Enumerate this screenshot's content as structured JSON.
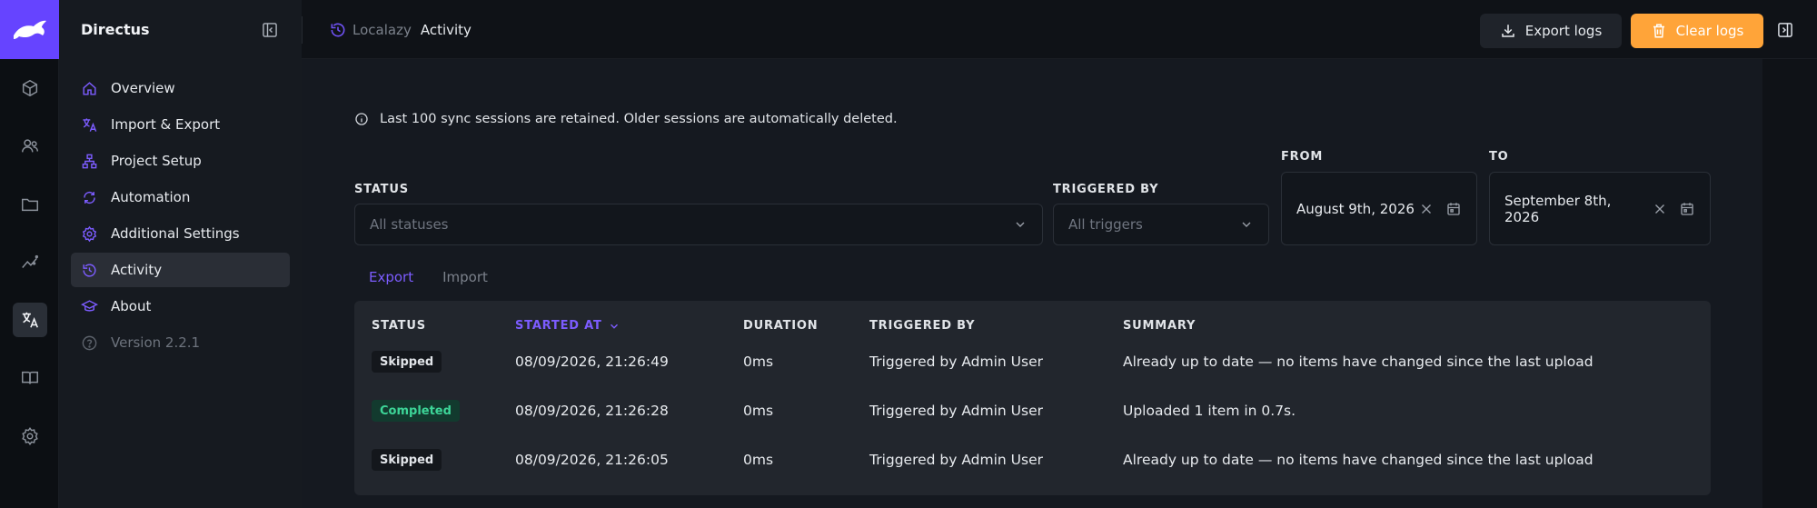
{
  "app": {
    "name": "Directus"
  },
  "modules": [
    {
      "name": "content",
      "icon": "cube-icon"
    },
    {
      "name": "users",
      "icon": "users-icon"
    },
    {
      "name": "files",
      "icon": "folder-icon"
    },
    {
      "name": "insights",
      "icon": "insights-icon"
    },
    {
      "name": "localazy",
      "icon": "translate-icon",
      "active": true
    },
    {
      "name": "docs",
      "icon": "book-icon"
    },
    {
      "name": "settings",
      "icon": "gear-icon"
    }
  ],
  "nav": {
    "items": [
      {
        "label": "Overview",
        "icon": "home-icon"
      },
      {
        "label": "Import & Export",
        "icon": "translate-icon"
      },
      {
        "label": "Project Setup",
        "icon": "sitemap-icon"
      },
      {
        "label": "Automation",
        "icon": "automation-icon"
      },
      {
        "label": "Additional Settings",
        "icon": "gear-icon"
      },
      {
        "label": "Activity",
        "icon": "history-icon",
        "active": true
      },
      {
        "label": "About",
        "icon": "school-icon"
      },
      {
        "label": "Version 2.2.1",
        "icon": "help-icon",
        "muted": true
      }
    ]
  },
  "header": {
    "breadcrumb_parent": "Localazy",
    "title": "Activity",
    "export_label": "Export logs",
    "clear_label": "Clear logs"
  },
  "notice": "Last 100 sync sessions are retained. Older sessions are automatically deleted.",
  "filters": {
    "status_label": "STATUS",
    "status_placeholder": "All statuses",
    "triggered_label": "TRIGGERED BY",
    "triggered_placeholder": "All triggers",
    "from_label": "FROM",
    "from_value": "August 9th, 2026",
    "to_label": "TO",
    "to_value": "September 8th, 2026"
  },
  "tabs": [
    {
      "label": "Export",
      "active": true
    },
    {
      "label": "Import",
      "active": false
    }
  ],
  "table": {
    "headers": {
      "status": "STATUS",
      "started_at": "STARTED AT",
      "duration": "DURATION",
      "triggered_by": "TRIGGERED BY",
      "summary": "SUMMARY"
    },
    "rows": [
      {
        "status": "Skipped",
        "started_at": "08/09/2026, 21:26:49",
        "duration": "0ms",
        "triggered_by": "Triggered by Admin User",
        "summary": "Already up to date — no items have changed since the last upload"
      },
      {
        "status": "Completed",
        "started_at": "08/09/2026, 21:26:28",
        "duration": "0ms",
        "triggered_by": "Triggered by Admin User",
        "summary": "Uploaded 1 item in 0.7s."
      },
      {
        "status": "Skipped",
        "started_at": "08/09/2026, 21:26:05",
        "duration": "0ms",
        "triggered_by": "Triggered by Admin User",
        "summary": "Already up to date — no items have changed since the last upload"
      }
    ]
  },
  "colors": {
    "accent": "#6644ff",
    "warning": "#ffa439",
    "success": "#3dd598"
  }
}
